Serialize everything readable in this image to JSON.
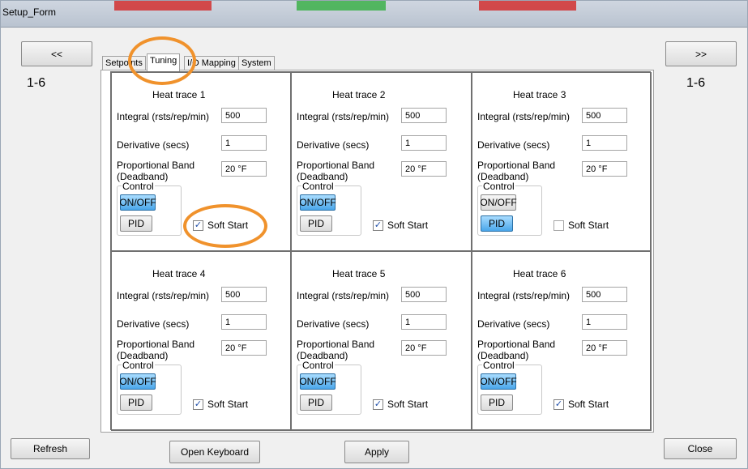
{
  "window": {
    "title": "Setup_Form"
  },
  "nav": {
    "prev_label": "<<",
    "next_label": ">>",
    "left_range": "1-6",
    "right_range": "1-6"
  },
  "tabs": [
    {
      "label": "Setpoints",
      "active": false
    },
    {
      "label": "Tuning",
      "active": true
    },
    {
      "label": "I/O Mapping",
      "active": false
    },
    {
      "label": "System",
      "active": false
    }
  ],
  "labels": {
    "integral": "Integral (rsts/rep/min)",
    "derivative": "Derivative (secs)",
    "prop_band_1": "Proportional Band",
    "prop_band_2": "(Deadband)",
    "control": "Control",
    "on_off": "ON/OFF",
    "pid": "PID",
    "soft_start": "Soft Start"
  },
  "traces": [
    {
      "title": "Heat trace 1",
      "integral": "500",
      "derivative": "1",
      "prop_band": "20 °F",
      "mode": "ON/OFF",
      "soft_start": true
    },
    {
      "title": "Heat trace 2",
      "integral": "500",
      "derivative": "1",
      "prop_band": "20 °F",
      "mode": "ON/OFF",
      "soft_start": true
    },
    {
      "title": "Heat trace 3",
      "integral": "500",
      "derivative": "1",
      "prop_band": "20 °F",
      "mode": "PID",
      "soft_start": false
    },
    {
      "title": "Heat trace 4",
      "integral": "500",
      "derivative": "1",
      "prop_band": "20 °F",
      "mode": "ON/OFF",
      "soft_start": true
    },
    {
      "title": "Heat trace 5",
      "integral": "500",
      "derivative": "1",
      "prop_band": "20 °F",
      "mode": "ON/OFF",
      "soft_start": true
    },
    {
      "title": "Heat trace 6",
      "integral": "500",
      "derivative": "1",
      "prop_band": "20 °F",
      "mode": "ON/OFF",
      "soft_start": true
    }
  ],
  "footer": {
    "refresh": "Refresh",
    "open_keyboard": "Open Keyboard",
    "apply": "Apply",
    "close": "Close"
  },
  "colors": {
    "highlight_ring": "#f0922c",
    "active_toggle": "#4aa6ea"
  }
}
